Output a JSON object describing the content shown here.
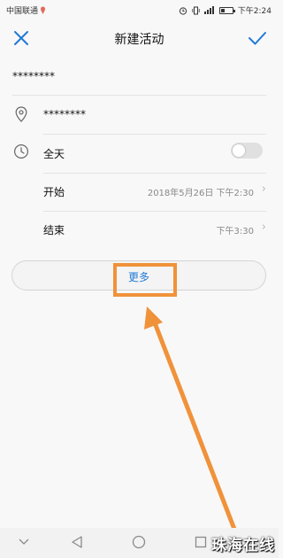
{
  "status": {
    "carrier": "中国联通",
    "time": "下午2:24"
  },
  "header": {
    "title": "新建活动",
    "close_icon": "close-icon",
    "confirm_icon": "check-icon",
    "accent": "#1f7ad6"
  },
  "form": {
    "title_value": "********",
    "location_value": "********",
    "allday_label": "全天",
    "allday_on": false,
    "start_label": "开始",
    "start_value": "2018年5月26日 下午2:30",
    "end_label": "结束",
    "end_value": "下午3:30",
    "more_label": "更多"
  },
  "annotation": {
    "color": "#f0923a"
  },
  "navbar": {
    "icons": [
      "chevron-down-icon",
      "back-icon",
      "home-icon",
      "recents-icon"
    ]
  },
  "watermark": "珠海在线"
}
